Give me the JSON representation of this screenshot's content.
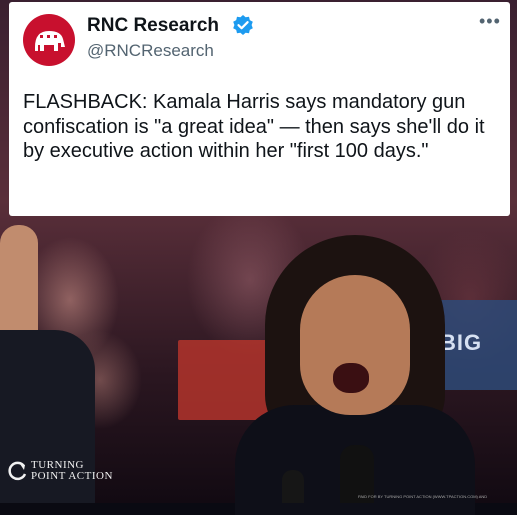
{
  "tweet": {
    "display_name": "RNC Research",
    "handle": "@RNCResearch",
    "more_icon": "more-horizontal-icon",
    "verified_icon": "verified-badge-icon",
    "avatar_icon": "elephant-logo-icon",
    "text": "FLASHBACK: Kamala Harris says mandatory gun confiscation is \"a great idea\" — then says she'll do it by executive action within her \"first 100 days.\""
  },
  "photo": {
    "sign_text": "BIG"
  },
  "watermark": {
    "line1": "TURNING",
    "line2": "POINT ACTION",
    "fine_print": "PAID FOR BY TURNING POINT ACTION (WWW.TPACTION.COM) AND"
  },
  "colors": {
    "brand_red": "#c8102e",
    "verified_blue": "#1d9bf0",
    "card_bg": "#ffffff",
    "text_primary": "#0f1419",
    "text_secondary": "#536471"
  }
}
